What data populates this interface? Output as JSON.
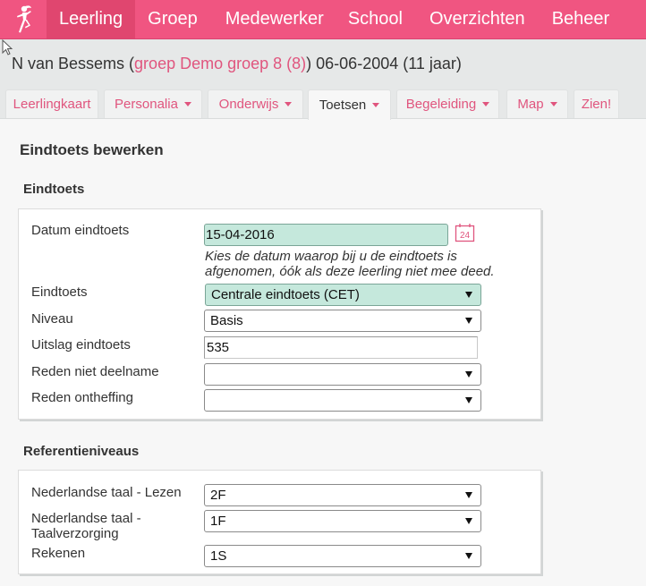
{
  "nav": {
    "logo_icon": "dancing-figure-icon",
    "items": [
      {
        "label": "Leerling",
        "active": true
      },
      {
        "label": "Groep"
      },
      {
        "label": "Medewerker"
      },
      {
        "label": "School"
      },
      {
        "label": "Overzichten"
      },
      {
        "label": "Beheer"
      }
    ]
  },
  "student": {
    "name": "N van Bessems",
    "open_paren": " (",
    "group_link": "groep Demo groep 8 (8)",
    "close_paren": ")",
    "birth_info": " 06-06-2004 (11 jaar)"
  },
  "tabs": [
    {
      "label": "Leerlingkaart",
      "dropdown": false
    },
    {
      "label": "Personalia",
      "dropdown": true
    },
    {
      "label": "Onderwijs",
      "dropdown": true
    },
    {
      "label": "Toetsen",
      "dropdown": true,
      "active": true
    },
    {
      "label": "Begeleiding",
      "dropdown": true
    },
    {
      "label": "Map",
      "dropdown": true
    },
    {
      "label": "Zien!",
      "dropdown": false
    }
  ],
  "page": {
    "title": "Eindtoets bewerken"
  },
  "eindtoets": {
    "section_title": "Eindtoets",
    "datum_label": "Datum eindtoets",
    "datum_value": "15-04-2016",
    "calendar_day": "24",
    "datum_hint": "Kies de datum waarop bij u de eindtoets is afgenomen, óók als deze leerling niet mee deed.",
    "eindtoets_label": "Eindtoets",
    "eindtoets_value": "Centrale eindtoets (CET)",
    "niveau_label": "Niveau",
    "niveau_value": "Basis",
    "uitslag_label": "Uitslag eindtoets",
    "uitslag_value": "535",
    "reden_niet_label": "Reden niet deelname",
    "reden_niet_value": "",
    "reden_onth_label": "Reden ontheffing",
    "reden_onth_value": ""
  },
  "referentie": {
    "section_title": "Referentieniveaus",
    "lezen_label": "Nederlandse taal - Lezen",
    "lezen_value": "2F",
    "taalverz_label_1": "Nederlandse taal -",
    "taalverz_label_2": "Taalverzorging",
    "taalverz_value": "1F",
    "rekenen_label": "Rekenen",
    "rekenen_value": "1S"
  },
  "colors": {
    "brand": "#f05581",
    "link": "#e0557e",
    "highlight_field": "#c5e8dc"
  }
}
